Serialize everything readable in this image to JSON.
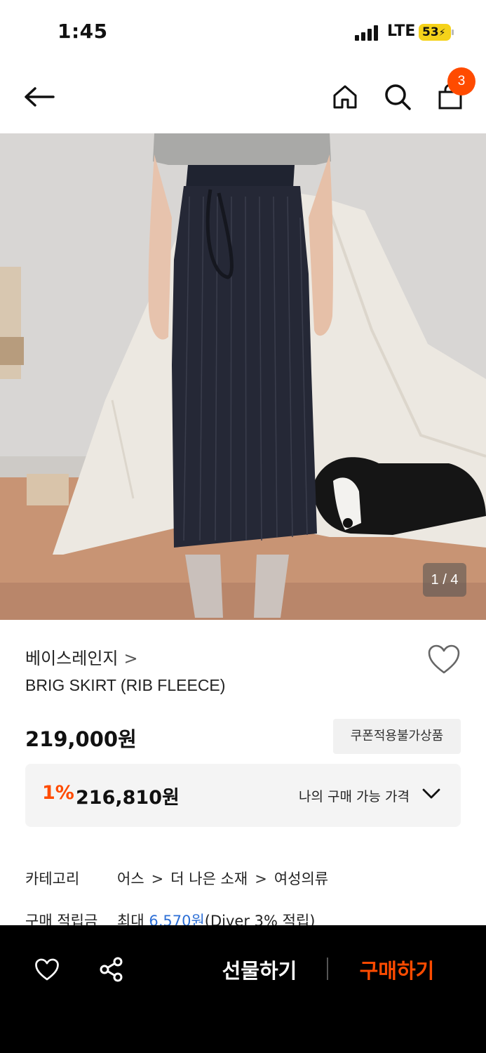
{
  "status_bar": {
    "time": "1:45",
    "network": "LTE",
    "battery": "53"
  },
  "nav": {
    "cart_count": "3"
  },
  "gallery": {
    "counter": "1 / 4"
  },
  "product": {
    "brand": "베이스레인지",
    "brand_chevron": ">",
    "name": "BRIG SKIRT (RIB FLEECE)",
    "price": "219,000원",
    "coupon_note": "쿠폰적용불가상품"
  },
  "discount": {
    "rate": "1%",
    "price": "216,810원",
    "label": "나의 구매 가능 가격"
  },
  "info": {
    "category_key": "카테고리",
    "category_path": [
      "어스",
      "더 나은 소재",
      "여성의류"
    ],
    "category_sep": ">",
    "points_key": "구매 적립금",
    "points_prefix": "최대 ",
    "points_value": "6,570원",
    "points_suffix": "(Diver 3% 적립)"
  },
  "bottom": {
    "gift_label": "선물하기",
    "buy_label": "구매하기"
  },
  "colors": {
    "accent": "#ff4b00",
    "link_blue": "#2d6fd6",
    "bar_bg": "#000000",
    "battery": "#f5d21a"
  }
}
